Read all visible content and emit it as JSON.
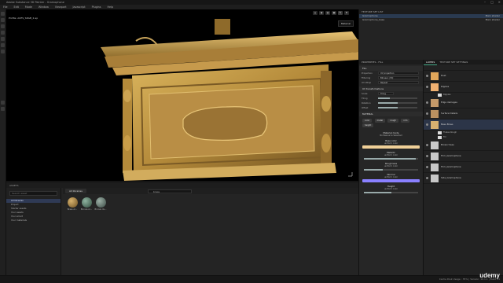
{
  "window": {
    "title": "Adobe Substance 3D Painter - Gramophone"
  },
  "menu": [
    "File",
    "Edit",
    "Mode",
    "Window",
    "Viewport",
    "Javascript",
    "Plugins",
    "Help"
  ],
  "viewport": {
    "label": "Profile: ACES_SRGB_2.ap",
    "material_select": "Material",
    "mode_icons": [
      "pause-icon",
      "camera-icon",
      "split-icon",
      "grid-icon",
      "brush-icon",
      "settings-icon"
    ]
  },
  "shelf": {
    "title": "ASSETS",
    "search_placeholder": "Search asset",
    "tree": [
      "All libraries",
      "Project",
      "Starter assets",
      "Your assets",
      "Your smart",
      "Your materials"
    ],
    "selected_tree_index": 0,
    "tab": "All libraries",
    "search_value": "brass",
    "items": [
      {
        "name": "Brass Ar...",
        "color": "#8a6b3a"
      },
      {
        "name": "Bronze Ar...",
        "color": "#4f6b5a"
      },
      {
        "name": "Bronze Ve...",
        "color": "#5a6a63"
      }
    ]
  },
  "texture_set": {
    "title": "TEXTURE SET LIST",
    "rows": [
      {
        "name": "Gramophone",
        "right": "Main shader",
        "shader": "Gramophone",
        "selected": true
      },
      {
        "name": "Gramophone_base",
        "right": "Main shader",
        "shader": "Gramophone_base",
        "selected": false
      }
    ]
  },
  "properties": {
    "title": "PROPERTIES - FILL",
    "section_fill": "FILL",
    "rows": [
      {
        "label": "Projection",
        "value": "UV projection"
      },
      {
        "label": "Filtering",
        "value": "Bilinear | HQ"
      },
      {
        "label": "UV Wrap",
        "value": "Repeat"
      }
    ],
    "uv_section": "UV transformations",
    "scale_label": "Scale",
    "scale_value": "Tiling",
    "tiling_label": "Tiling",
    "rotation_label": "Rotation",
    "offset_label": "Offset",
    "material_section": "MATERIAL",
    "chips": [
      "color",
      "metal",
      "rough",
      "nrm",
      "height"
    ],
    "channels": [
      {
        "name": "Base color",
        "sub": "uniform color",
        "color": "#f0d098"
      },
      {
        "name": "Metallic",
        "sub": "uniform color",
        "slider": 0.95
      },
      {
        "name": "Roughness",
        "sub": "uniform color",
        "slider": 0.35
      },
      {
        "name": "Normal",
        "sub": "uniform color",
        "color": "#8a80ff"
      },
      {
        "name": "Height",
        "sub": "uniform color",
        "slider": 0.5
      }
    ],
    "material_mode_label": "Material mode",
    "material_mode_value": "No Resource Selected"
  },
  "layers": {
    "tabs": [
      "LAYERS",
      "TEXTURE SET SETTINGS"
    ],
    "active_tab": 0,
    "list": [
      {
        "name": "Dust",
        "swatch": "#e0a65a",
        "subs": []
      },
      {
        "name": "Ripples",
        "swatch": "#f0b070",
        "subs": [
          {
            "name": "Ripples"
          }
        ]
      },
      {
        "name": "Edge damages",
        "swatch": "#c49a6a",
        "subs": []
      },
      {
        "name": "Surface Details",
        "swatch": "#b99060",
        "subs": []
      },
      {
        "name": "Base Brass",
        "swatch": "#d8b070",
        "selected": true,
        "subs": [
          {
            "name": "Flakes Rough"
          },
          {
            "name": "Fill"
          }
        ]
      },
      {
        "name": "Brown trees",
        "swatch": "#c8c8c8",
        "folder": true,
        "subs": []
      },
      {
        "name": "Trim_Gramophone",
        "swatch": "#c8c8c8",
        "folder": true,
        "subs": []
      },
      {
        "name": "Trim_Gramophone",
        "swatch": "#c8c8c8",
        "folder": true,
        "subs": []
      },
      {
        "name": "Side_Gramophone",
        "swatch": "#c8c8c8",
        "folder": true,
        "subs": []
      }
    ]
  },
  "status": {
    "text": "Cache Disk Usage : 35% | Version: 10.1.1 | Build 81",
    "watermark": "udemy"
  }
}
